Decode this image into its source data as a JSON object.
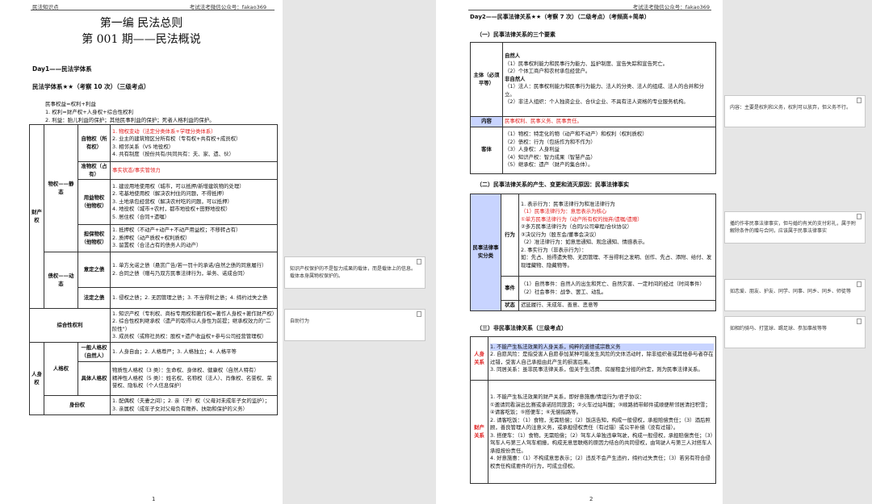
{
  "header": {
    "left": "民法知识点",
    "right": "考试法考微信公众号：fakao369"
  },
  "p1": {
    "title1": "第一编 民法总则",
    "title2": "第 001 期——民法概说",
    "day": "Day1——民法学体系",
    "sub": "民法学体系★★（考察 10 次）（三级考点）",
    "l1": "民事权益=权利+利益",
    "l2": "1. 权利=财产权+人身权+综合性权利",
    "l3": "2. 利益：胎儿利益的保护；其他民事利益的保护；死者人格利益的保护。",
    "rows": [
      {
        "a": "财产权",
        "b": "物权——静态",
        "c": "自物权（所有权）",
        "d": [
          "1. 物权变动（法定分类体系+学理分类体系）",
          "2. 业主的建筑物区分所有权（专有权+共有权+成员权）",
          "3. 相邻关系（VS 地役权）",
          "4. 共有制度（按份共有/共同共有：夫、家、遗、伙）"
        ]
      },
      {
        "c": "准物权（占有）",
        "d": [
          "事实状态/事实管领力"
        ]
      },
      {
        "c": "用益物权（他物权）",
        "d": [
          "1. 建设用地使用权（城市，可以抵押/新增建筑物的处理）",
          "2. 宅基地使用权（解决农村住的问题，不得抵押）",
          "3. 土地承包经营权（解决农村吃的问题，可以抵押）",
          "4. 地役权（城市+农村，都市地役权+田野地役权）",
          "5. 居住权（合同+遗嘱）"
        ]
      },
      {
        "c": "担保物权（他物权）",
        "d": [
          "1. 抵押权（不动产+动产+不动产用益权；不移转占有）",
          "2. 质押权（动产质权+权利质权）",
          "3. 留置权（合法占有的债务人的动产）"
        ]
      },
      {
        "b": "债权——动态",
        "c": "意定之债",
        "d": [
          "1. 单方允诺之债（悬赏广告/若一罚十的承诺/自然之债的同意履行）",
          "2. 合同之债（赠与乃双方民事法律行为，单务、诺成合同）"
        ]
      },
      {
        "c": "法定之债",
        "d": [
          "1. 侵权之债；2. 无因管理之债；3. 不当得利之债；4. 缔约过失之债"
        ]
      },
      {
        "a": "综合性权利",
        "d": [
          "1. 知识产权（专利权、商标专用权和著作权=著作人身权+著作财产权）",
          "2. 综合性权利继承权（遗产的取得以人身性为前提；继承权效力的\"二阶性\"）",
          "3. 成员权（或称社员权：股权+遗产收益权+参与公司经营管理权）"
        ]
      },
      {
        "a": "人身权",
        "b": "人格权",
        "c": "一般人格权（自然人）",
        "d": [
          "1. 人身自由；2. 人格尊严；3. 人格独立；4. 人格平等"
        ]
      },
      {
        "c": "具体人格权",
        "d": [
          "物质性人格权（3 类）：生命权、身体权、健康权（自然人特有）",
          "精神性人格权（5 类）：姓名权、名称权（法人）、肖像权、名誉权、荣誉权、隐私权（个人信息保护）"
        ]
      },
      {
        "b": "身份权",
        "d": [
          "1. 配偶权（夫妻之间）；2. 亲（子）权（父母对未成年子女的监护）；",
          "3. 亲属权（成年子女对父母负有赡养、扶助和保护的义务）"
        ]
      }
    ],
    "page": "1"
  },
  "p2": {
    "day": "Day2——民事法律关系★★（考察 7 次）（二级考点）（考频高+简单）",
    "s1": "（一）民事法律关系的三个要素",
    "t1": [
      {
        "a": "主体（必须平等）",
        "lines": [
          "自然人",
          "（1）民事权利能力和民事行为能力、监护制度、宣告失踪和宣告死亡。",
          "（2）个体工商户和农村承包经营户。",
          "非自然人",
          "（1）法人：民事权利能力和民事行为能力、法人的分类、法人的组成、法人的合并和分立。",
          "（2）非法人组织：个人独资企业、合伙企业、不具有法人资格的专业服务机构。"
        ]
      },
      {
        "a": "内容",
        "lines": [
          "民事权利、民事义务、民事责任。"
        ]
      },
      {
        "a": "客体",
        "lines": [
          "（1）物权：特定化的物（动产和不动产）和权利（权利质权）",
          "（2）债权：行为（包括作为和不作为）",
          "（3）人身权：人身利益",
          "（4）知识产权：智力成果（智慧产品）",
          "（5）继承权：遗产（财产的集合体）。"
        ]
      }
    ],
    "s2": "（二）民事法律关系的产生、变更和消灭原因：民事法律事实",
    "t2": [
      {
        "a": "民事法律事实分类",
        "b": "行为",
        "lines": [
          "1. 表示行为：民事法律行为和准法律行为",
          "（1）民事法律行为：意思表示为核心",
          "①单方民事法律行为（动产所有权的抛弃/遗嘱/遗赠）",
          "②多方民事法律行为（合同/公司章程/合伙协议）",
          "③决议行为（股东会/董事会决议）",
          "（2）准法律行为：如意思通知、观念通知、情感表示。",
          "2. 事实行为（非表示行为）：",
          "如：先占、拾得遗失物、无因管理、不当得利之发明、创作、先占、添附、给付、发现埋藏物、隐藏物等。"
        ]
      },
      {
        "b": "事件",
        "lines": [
          "（1）自然事件：自然人的出生和死亡、自然灾害、一定时间的经过（时间事件）",
          "（2）社会事件：战争、罢工、动乱。"
        ]
      },
      {
        "b": "状态",
        "lines": [
          "迟延履行、未成年、善意、恶意等"
        ]
      }
    ],
    "s3": "（三）非民事法律关系（三级考点）",
    "t3": [
      {
        "a": "人身关系",
        "lines": [
          "1. 不能产生私法效果的人身关系，纯粹的道德或宗教义务",
          "2. 自愿风险：是指受害人自愿参加某种可能发生风险的文体活动时，除非组织者或其他参与者存在过错，受害人自己承担由此产生的损害后果。",
          "3. 同居关系：虽非民事法律关系，但关于生活费、房屋租金分担的约定，则为民事法律关系。"
        ]
      },
      {
        "a": "财产关系",
        "lines": [
          "1. 不能产生私法效果的财产关系，即好意施惠/情谊行为/君子协议：",
          "①邀请同看演出比赛或承诺陪同旅游；②火车过站叫醒；③顺路捎带邮件或顺便帮邻居清扫积雪；④请客吃饭；⑤搭便车；⑥无偿指路等。",
          "2. 请客吃饭：（1）食物，无需赔偿；（2）饭店告知，构成一般侵权，承担赔偿责任；（3）酒后照顾，善良管理人的注意义务，或承担侵权责任（有过错）或公平补偿（没有过错）。",
          "3. 搭便车：（1）食物，无需赔偿；（2）驾车人单独违章驾驶，构成一般侵权，承担赔偿责任；（3）驾车人与第三人驾车相撞，构成无意思联络的原因力结合的共同侵权，由驾驶人与第三人对搭车人承担按份责任。",
          "4. 好意施惠：（1）不构成意思表示；（2）违反不会产生违约，缔约过失责任；（3）若另有符合侵权责任构成要件的行为，可成立侵权。"
        ]
      }
    ],
    "page": "2"
  },
  "notes": [
    {
      "text": "知识产权保护的不是智力成果的载体，而是载体上的信息。载体本身属物权保护的。"
    },
    {
      "text": "自助行为"
    },
    {
      "text": "内容：主要是权利和义务，权利可以放弃，但义务不行。"
    },
    {
      "text": "播约作非民事法律事实，但与婚约有关的支付彩礼，属于附解除条件的赠与合同，应该属于民事法律事实"
    },
    {
      "text": "如恋爱、朋友、护友、同学、同事、同乡、同乡、师徒等"
    },
    {
      "text": "如相约骑马、打篮球、踢足球、参加事故等等"
    }
  ]
}
